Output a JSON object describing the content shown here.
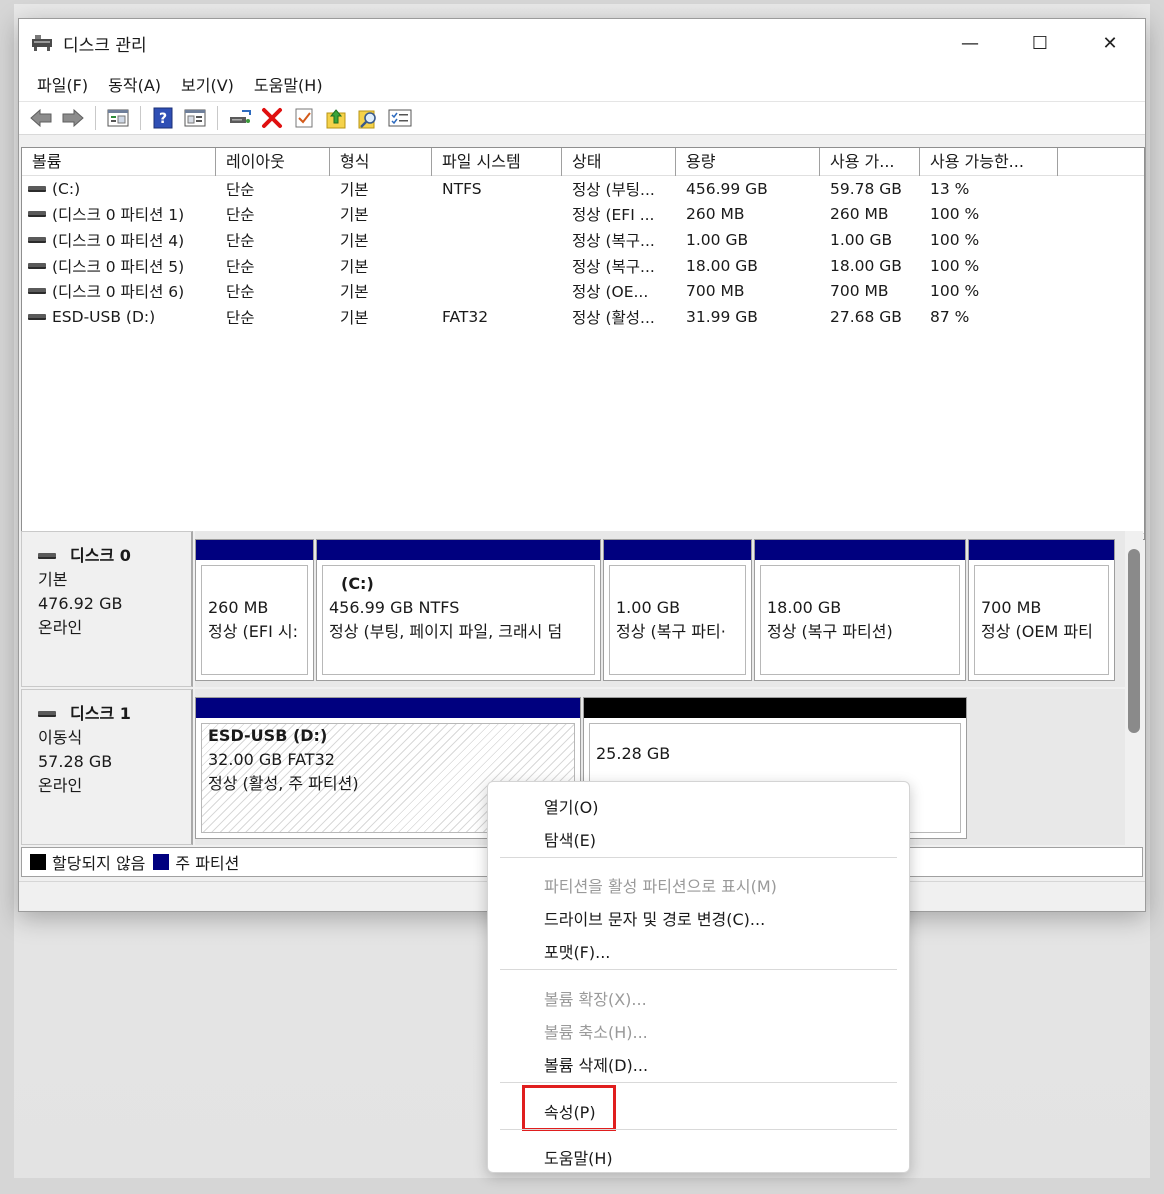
{
  "window": {
    "title": "디스크 관리",
    "controls": {
      "minimize": "—",
      "maximize": "☐",
      "close": "✕"
    }
  },
  "menubar": [
    "파일(F)",
    "동작(A)",
    "보기(V)",
    "도움말(H)"
  ],
  "toolbar": {
    "icons": [
      "back-icon",
      "forward-icon",
      "show-hide-tree-icon",
      "help-icon",
      "properties-view-icon",
      "connect-drive-icon",
      "delete-icon",
      "checklist-icon",
      "up-arrow-icon",
      "search-icon",
      "list-view-icon"
    ]
  },
  "volumes": {
    "columns": [
      "볼륨",
      "레이아웃",
      "형식",
      "파일 시스템",
      "상태",
      "용량",
      "사용 가...",
      "사용 가능한..."
    ],
    "rows": [
      [
        "(C:)",
        "단순",
        "기본",
        "NTFS",
        "정상 (부팅...",
        "456.99 GB",
        "59.78 GB",
        "13 %"
      ],
      [
        "(디스크 0 파티션 1)",
        "단순",
        "기본",
        "",
        "정상 (EFI ...",
        "260 MB",
        "260 MB",
        "100 %"
      ],
      [
        "(디스크 0 파티션 4)",
        "단순",
        "기본",
        "",
        "정상 (복구...",
        "1.00 GB",
        "1.00 GB",
        "100 %"
      ],
      [
        "(디스크 0 파티션 5)",
        "단순",
        "기본",
        "",
        "정상 (복구...",
        "18.00 GB",
        "18.00 GB",
        "100 %"
      ],
      [
        "(디스크 0 파티션 6)",
        "단순",
        "기본",
        "",
        "정상 (OE...",
        "700 MB",
        "700 MB",
        "100 %"
      ],
      [
        "ESD-USB (D:)",
        "단순",
        "기본",
        "FAT32",
        "정상 (활성...",
        "31.99 GB",
        "27.68 GB",
        "87 %"
      ]
    ]
  },
  "disks": [
    {
      "name": "디스크 0",
      "type": "기본",
      "size": "476.92 GB",
      "status": "온라인",
      "partitions": [
        {
          "title": "",
          "line1": "260 MB",
          "line2": "정상 (EFI 시:"
        },
        {
          "title": "(C:)",
          "line1": "456.99 GB NTFS",
          "line2": "정상 (부팅, 페이지 파일, 크래시 덤"
        },
        {
          "title": "",
          "line1": "1.00 GB",
          "line2": "정상 (복구 파티·"
        },
        {
          "title": "",
          "line1": "18.00 GB",
          "line2": "정상 (복구 파티션)"
        },
        {
          "title": "",
          "line1": "700 MB",
          "line2": "정상 (OEM 파티"
        }
      ]
    },
    {
      "name": "디스크 1",
      "type": "이동식",
      "size": "57.28 GB",
      "status": "온라인",
      "partitions": [
        {
          "title": "ESD-USB  (D:)",
          "line1": "32.00 GB FAT32",
          "line2": "정상 (활성, 주 파티션)"
        },
        {
          "title": "",
          "line1": "25.28 GB",
          "line2": ""
        }
      ]
    }
  ],
  "legend": [
    {
      "label": "할당되지 않음",
      "color": "#000000"
    },
    {
      "label": "주 파티션",
      "color": "#00007f"
    }
  ],
  "colors": {
    "primary_partition": "#00007f",
    "unallocated": "#000000",
    "highlight": "#e01e1e"
  },
  "context_menu": {
    "items": [
      {
        "label": "열기(O)",
        "enabled": true
      },
      {
        "label": "탐색(E)",
        "enabled": true
      },
      {
        "label": "파티션을 활성 파티션으로 표시(M)",
        "enabled": false
      },
      {
        "label": "드라이브 문자 및 경로 변경(C)...",
        "enabled": true
      },
      {
        "label": "포맷(F)...",
        "enabled": true
      },
      {
        "label": "볼륨 확장(X)...",
        "enabled": false
      },
      {
        "label": "볼륨 축소(H)...",
        "enabled": false
      },
      {
        "label": "볼륨 삭제(D)...",
        "enabled": true
      },
      {
        "label": "속성(P)",
        "enabled": true,
        "highlighted": true
      },
      {
        "label": "도움말(H)",
        "enabled": true
      }
    ]
  }
}
